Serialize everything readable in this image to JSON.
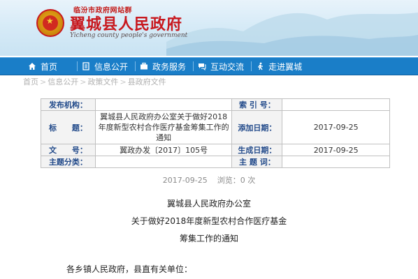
{
  "header": {
    "portal_label": "临汾市政府网站群",
    "title": "翼城县人民政府",
    "subtitle": "Yicheng county people's government"
  },
  "nav": {
    "items": [
      {
        "label": "首页",
        "icon": "home-icon"
      },
      {
        "label": "信息公开",
        "icon": "document-icon"
      },
      {
        "label": "政务服务",
        "icon": "briefcase-icon"
      },
      {
        "label": "互动交流",
        "icon": "chat-icon"
      },
      {
        "label": "走进翼城",
        "icon": "walk-icon"
      }
    ],
    "background_color": "#1a7ec8"
  },
  "breadcrumb": [
    "首页",
    "信息公开",
    "政策文件",
    "县政府文件"
  ],
  "info_table": {
    "publisher_label": "发布机构：",
    "publisher_value": "",
    "index_label": "索 引 号：",
    "index_value": "",
    "title_label": "标　　题：",
    "title_value": "翼城县人民政府办公室关于做好2018年度新型农村合作医疗基金筹集工作的通知",
    "date_label": "添加日期：",
    "date_value": "2017-09-25",
    "doc_no_label": "文　　号：",
    "doc_no_value": "翼政办发〔2017〕105号",
    "effective_label": "生成日期：",
    "effective_value": "2017-09-25",
    "category_label": "主题分类：",
    "category_value": "",
    "keywords_label": "主 题 词：",
    "keywords_value": ""
  },
  "meta": {
    "date": "2017-09-25",
    "views": "浏览：0 次"
  },
  "document": {
    "line1": "翼城县人民政府办公室",
    "line2": "关于做好2018年度新型农村合作医疗基金",
    "line3": "筹集工作的通知",
    "salutation": "各乡镇人民政府，县直有关单位："
  }
}
